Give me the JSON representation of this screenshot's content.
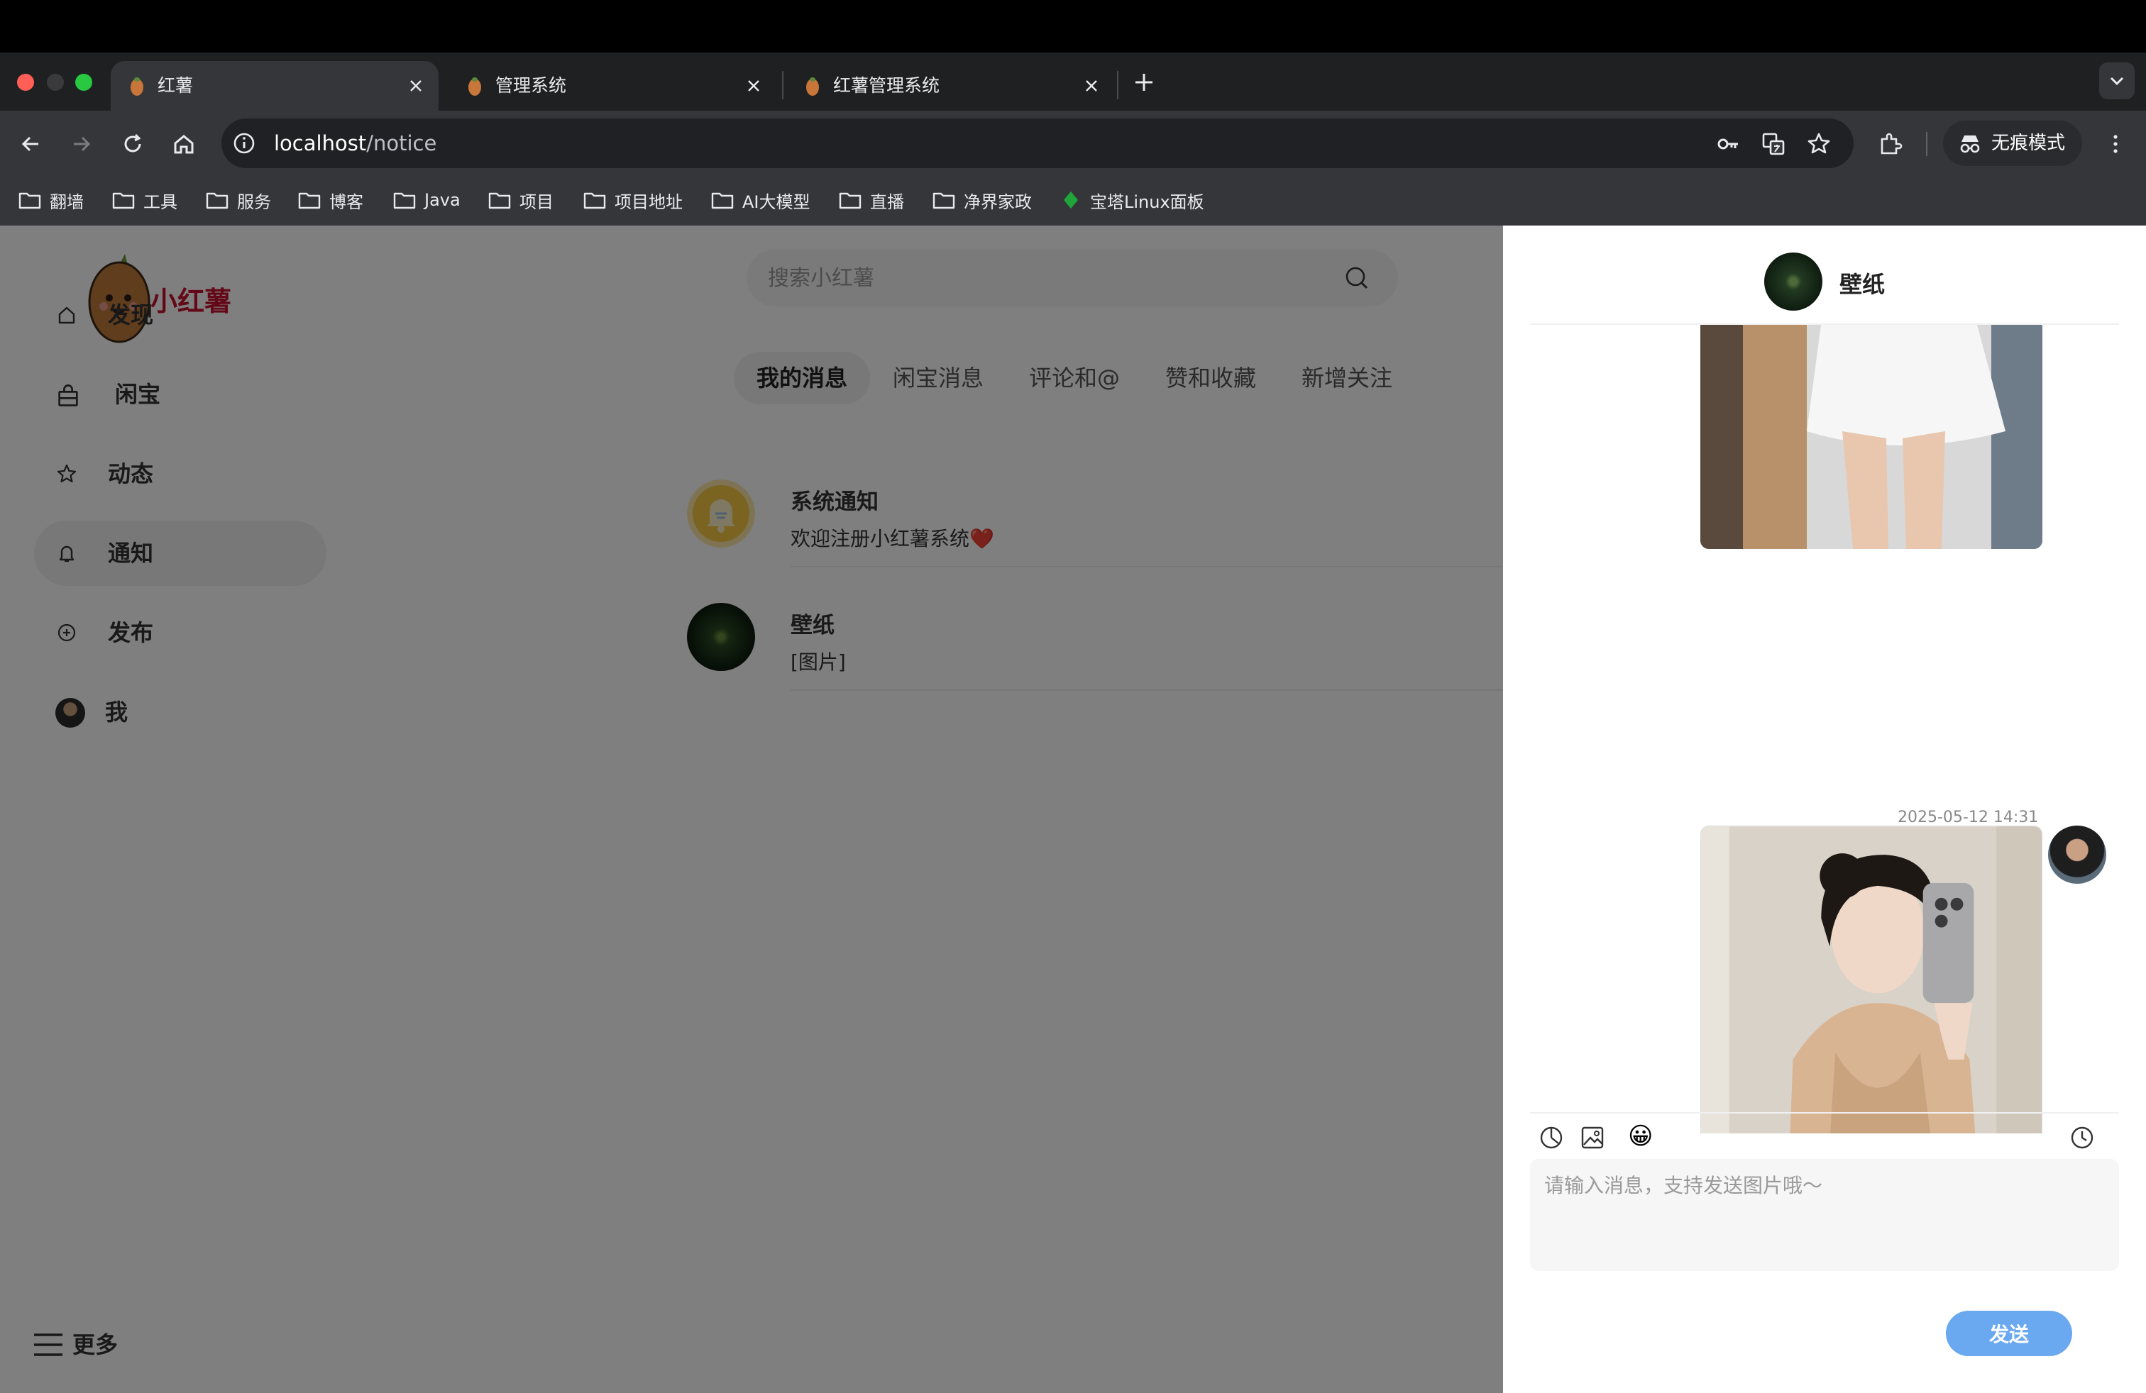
{
  "browser": {
    "tabs": [
      {
        "title": "红薯",
        "active": true
      },
      {
        "title": "管理系统",
        "active": false
      },
      {
        "title": "红薯管理系统",
        "active": false
      }
    ],
    "url_host": "localhost",
    "url_path": "/notice",
    "incognito_label": "无痕模式",
    "bookmarks": [
      "翻墙",
      "工具",
      "服务",
      "博客",
      "Java",
      "项目",
      "项目地址",
      "AI大模型",
      "直播",
      "净界家政",
      "宝塔Linux面板"
    ]
  },
  "app": {
    "brand": "小红薯",
    "sidebar": {
      "items": [
        {
          "label": "发现",
          "icon": "home-icon"
        },
        {
          "label": "闲宝",
          "icon": "shopping-bag-icon"
        },
        {
          "label": "动态",
          "icon": "star-icon"
        },
        {
          "label": "通知",
          "icon": "bell-icon",
          "active": true
        },
        {
          "label": "发布",
          "icon": "plus-circle-icon"
        },
        {
          "label": "我",
          "icon": "avatar"
        }
      ],
      "more_label": "更多"
    },
    "search": {
      "placeholder": "搜索小红薯"
    },
    "tabs": [
      "我的消息",
      "闲宝消息",
      "评论和@",
      "赞和收藏",
      "新增关注"
    ],
    "active_tab": "我的消息",
    "notices": [
      {
        "name": "系统通知",
        "message": "欢迎注册小红薯系统❤️"
      },
      {
        "name": "壁纸",
        "message": "[图片]"
      }
    ]
  },
  "chat": {
    "title": "壁纸",
    "timestamp": "2025-05-12 14:31",
    "input_placeholder": "请输入消息，支持发送图片哦～",
    "emoji": "😀",
    "send_label": "发送"
  },
  "colors": {
    "brand_red": "#c8102e",
    "send_button": "#6aa8ef",
    "overlay": "rgba(0,0,0,0.5)"
  }
}
